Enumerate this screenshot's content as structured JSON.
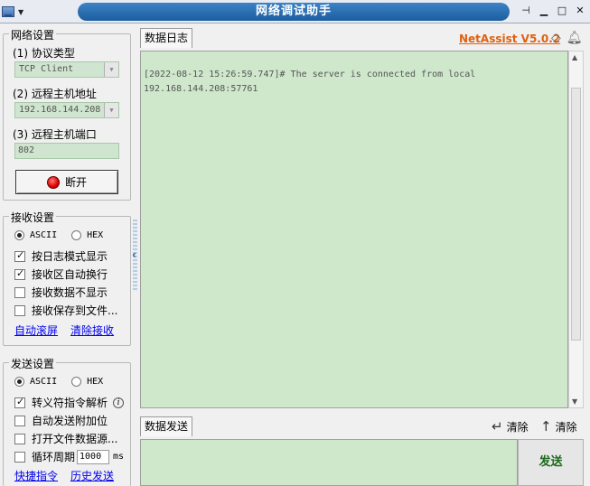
{
  "window": {
    "title": "网络调试助手"
  },
  "network": {
    "legend": "网络设置",
    "protocol_label": "(1) 协议类型",
    "protocol_value": "TCP Client",
    "host_label": "(2) 远程主机地址",
    "host_value": "192.168.144.208",
    "port_label": "(3) 远程主机端口",
    "port_value": "802",
    "disconnect_label": "断开"
  },
  "receive": {
    "legend": "接收设置",
    "ascii": "ASCII",
    "hex": "HEX",
    "options": [
      "按日志模式显示",
      "接收区自动换行",
      "接收数据不显示",
      "接收保存到文件..."
    ],
    "auto_scroll": "自动滚屏",
    "clear_receive": "清除接收"
  },
  "send": {
    "legend": "发送设置",
    "ascii": "ASCII",
    "hex": "HEX",
    "options": [
      "转义符指令解析",
      "自动发送附加位",
      "打开文件数据源...",
      "循环周期"
    ],
    "period_value": "1000",
    "period_unit": "ms",
    "shortcuts": "快捷指令",
    "history": "历史发送"
  },
  "log_tab": {
    "label": "数据日志"
  },
  "brand": "NetAssist V5.0.2",
  "log": {
    "text": "[2022-08-12 15:26:59.747]# The server is connected from local\n192.168.144.208:57761"
  },
  "send_area": {
    "tab_label": "数据发送",
    "clear1": "清除",
    "clear2": "清除",
    "send_button": "发送"
  }
}
